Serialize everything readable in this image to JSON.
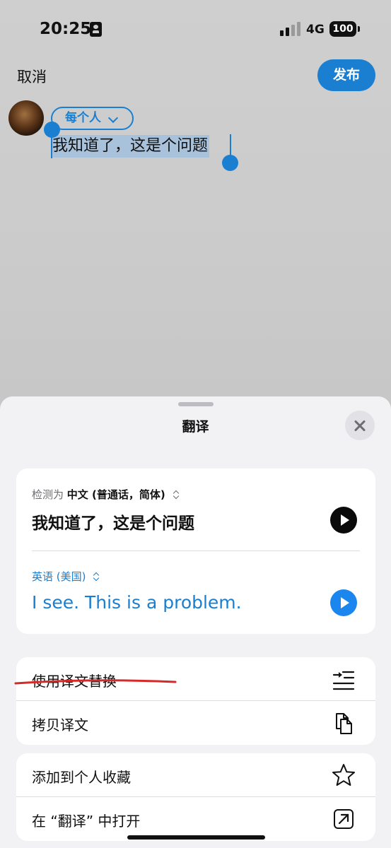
{
  "status_bar": {
    "time": "20:25",
    "network": "4G",
    "battery": "100"
  },
  "compose": {
    "cancel_label": "取消",
    "publish_label": "发布",
    "audience_label": "每个人",
    "selected_text": "我知道了，这是个问题"
  },
  "sheet": {
    "title": "翻译",
    "source": {
      "detect_prefix": "检测为",
      "language": "中文 (普通话，简体)",
      "text": "我知道了，这是个问题"
    },
    "target": {
      "language": "英语 (美国)",
      "text": "I see. This is a problem."
    },
    "actions": [
      {
        "label": "使用译文替换",
        "icon": "replace-icon"
      },
      {
        "label": "拷贝译文",
        "icon": "copy-icon"
      },
      {
        "label": "添加到个人收藏",
        "icon": "star-icon"
      },
      {
        "label": "在 “翻译” 中打开",
        "icon": "open-external-icon"
      }
    ]
  },
  "colors": {
    "accent": "#1a7fd0",
    "annotation": "#d42a2a"
  }
}
